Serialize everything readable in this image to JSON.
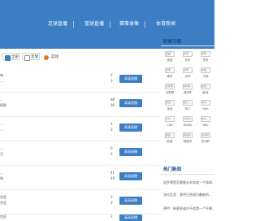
{
  "nav": {
    "items": [
      "足球直播",
      "篮球直播",
      "赛事录像",
      "体育新闻"
    ]
  },
  "filters": {
    "options": [
      {
        "label": "全部",
        "checked": true
      },
      {
        "label": "足球",
        "checked": false
      }
    ],
    "third_label": "篮球"
  },
  "matches": [
    {
      "team_a": "林...",
      "team_b": "...",
      "score_a": "3",
      "score_b": "3",
      "button": "高清直播"
    },
    {
      "team_a": "...",
      "team_b": "德联",
      "score_a": "98",
      "score_b": "96",
      "button": "高清直播"
    },
    {
      "team_a": "...",
      "team_b": "...",
      "score_a": "3",
      "score_b": "3",
      "button": "高清直播"
    },
    {
      "team_a": "...",
      "team_b": "旦",
      "score_a": "0",
      "score_b": "3",
      "button": "高清直播"
    },
    {
      "team_a": "...",
      "team_b": "和",
      "score_a": "41",
      "score_b": "49",
      "button": "高清直播"
    },
    {
      "team_a": "克亚",
      "team_b": "克亚",
      "score_a": "3",
      "score_b": "3",
      "button": "高清直播"
    },
    {
      "team_a": "克亚",
      "team_b": "克亚",
      "score_a": "3",
      "score_b": "3",
      "button": "高清直播"
    }
  ],
  "sidebar": {
    "leagues_title": "联赛专题",
    "leagues": [
      {
        "img_alt": "英超",
        "label": "英超"
      },
      {
        "img_alt": "西甲",
        "label": "西甲"
      },
      {
        "img_alt": "意甲",
        "label": "意甲"
      },
      {
        "img_alt": "德甲",
        "label": "德甲"
      },
      {
        "img_alt": "法甲",
        "label": "法甲"
      },
      {
        "img_alt": "中超",
        "label": "中超"
      },
      {
        "img_alt": "日职联",
        "label": "日职联"
      },
      {
        "img_alt": "韩K联",
        "label": "韩K联"
      },
      {
        "img_alt": "欧冠",
        "label": "欧冠"
      },
      {
        "img_alt": "英冠",
        "label": "英冠"
      },
      {
        "img_alt": "西乙",
        "label": "西乙"
      },
      {
        "img_alt": "NBA",
        "label": "NBA"
      },
      {
        "img_alt": "CBA",
        "label": "CBA"
      },
      {
        "img_alt": "WNBA",
        "label": "WNBA"
      },
      {
        "img_alt": "NBL",
        "label": "NBL"
      },
      {
        "img_alt": "欧篮",
        "label": "欧篮"
      },
      {
        "img_alt": "韩篮甲",
        "label": "韩篮甲"
      },
      {
        "img_alt": "亚洲杯",
        "label": "亚洲杯"
      }
    ],
    "news_title": "热门新闻",
    "news": [
      "加罗德是否需要去本年度一个排球...",
      "法拉瓦里：意甲已经成为最新的...",
      "德甲：新赛季或许不会是一个平静..."
    ]
  }
}
